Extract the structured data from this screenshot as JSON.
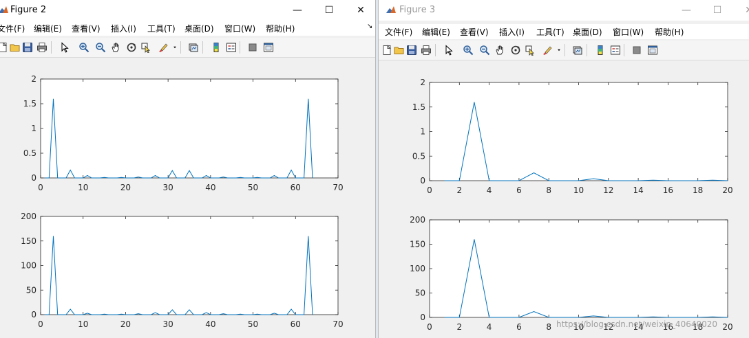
{
  "colors": {
    "line": "#0072bd",
    "axis": "#262626",
    "plot_bg": "#ffffff",
    "figure_bg": "#f0f0f0"
  },
  "windows": [
    {
      "id": "fig2",
      "title": "Figure 2",
      "icon": "matlab-icon",
      "controls": {
        "minimize": "—",
        "maximize": "☐",
        "close": "✕"
      },
      "menu": [
        "文件(F)",
        "编辑(E)",
        "查看(V)",
        "插入(I)",
        "工具(T)",
        "桌面(D)",
        "窗口(W)",
        "帮助(H)"
      ],
      "menu_arrow": "↘",
      "toolbar": [
        "new-figure-icon",
        "open-file-icon",
        "save-icon",
        "print-icon",
        "pointer-icon",
        "zoom-in-icon",
        "zoom-out-icon",
        "pan-icon",
        "rotate-3d-icon",
        "data-cursor-icon",
        "brush-icon",
        "brush-dropdown-icon",
        "link-plot-icon",
        "colorbar-icon",
        "legend-icon",
        "hide-plot-tools-icon",
        "show-plot-tools-icon"
      ]
    },
    {
      "id": "fig3",
      "title": "Figure 3",
      "icon": "matlab-icon",
      "controls": {
        "minimize": "—",
        "maximize": "☐",
        "close": "✕"
      },
      "menu": [
        "文件(F)",
        "编辑(E)",
        "查看(V)",
        "插入(I)",
        "工具(T)",
        "桌面(D)",
        "窗口(W)",
        "帮助(H)"
      ],
      "menu_arrow": "",
      "toolbar": [
        "new-figure-icon",
        "open-file-icon",
        "save-icon",
        "print-icon",
        "pointer-icon",
        "zoom-in-icon",
        "zoom-out-icon",
        "pan-icon",
        "rotate-3d-icon",
        "data-cursor-icon",
        "brush-icon",
        "brush-dropdown-icon",
        "link-plot-icon",
        "colorbar-icon",
        "legend-icon",
        "hide-plot-tools-icon",
        "show-plot-tools-icon"
      ]
    }
  ],
  "chart_data": [
    {
      "type": "line",
      "figure": "Figure 2",
      "xlim": [
        0,
        70
      ],
      "ylim": [
        0,
        2
      ],
      "xticks": [
        "0",
        "10",
        "20",
        "30",
        "40",
        "50",
        "60",
        "70"
      ],
      "yticks": [
        "0",
        "0.5",
        "1",
        "1.5",
        "2"
      ],
      "x": [
        1,
        2,
        3,
        4,
        5,
        6,
        7,
        8,
        9,
        10,
        11,
        12,
        13,
        14,
        15,
        16,
        17,
        18,
        19,
        20,
        21,
        22,
        23,
        24,
        25,
        26,
        27,
        28,
        29,
        30,
        31,
        32,
        33,
        34,
        35,
        36,
        37,
        38,
        39,
        40,
        41,
        42,
        43,
        44,
        45,
        46,
        47,
        48,
        49,
        50,
        51,
        52,
        53,
        54,
        55,
        56,
        57,
        58,
        59,
        60,
        61,
        62,
        63,
        64
      ],
      "y": [
        0,
        0,
        1.6,
        0,
        0,
        0,
        0.16,
        0,
        0,
        0,
        0.05,
        0,
        0,
        0,
        0.01,
        0,
        0,
        0,
        0.01,
        0,
        0,
        0,
        0.02,
        0,
        0,
        0,
        0.05,
        0,
        0,
        0,
        0.15,
        0,
        0,
        0,
        0.15,
        0,
        0,
        0,
        0.05,
        0,
        0,
        0,
        0.02,
        0,
        0,
        0,
        0.01,
        0,
        0,
        0,
        0.01,
        0,
        0,
        0,
        0.05,
        0,
        0,
        0,
        0.16,
        0,
        0,
        0,
        1.6,
        0
      ]
    },
    {
      "type": "line",
      "figure": "Figure 2",
      "xlim": [
        0,
        70
      ],
      "ylim": [
        0,
        200
      ],
      "xticks": [
        "0",
        "10",
        "20",
        "30",
        "40",
        "50",
        "60",
        "70"
      ],
      "yticks": [
        "0",
        "50",
        "100",
        "150",
        "200"
      ],
      "x": [
        1,
        2,
        3,
        4,
        5,
        6,
        7,
        8,
        9,
        10,
        11,
        12,
        13,
        14,
        15,
        16,
        17,
        18,
        19,
        20,
        21,
        22,
        23,
        24,
        25,
        26,
        27,
        28,
        29,
        30,
        31,
        32,
        33,
        34,
        35,
        36,
        37,
        38,
        39,
        40,
        41,
        42,
        43,
        44,
        45,
        46,
        47,
        48,
        49,
        50,
        51,
        52,
        53,
        54,
        55,
        56,
        57,
        58,
        59,
        60,
        61,
        62,
        63,
        64
      ],
      "y": [
        0,
        0,
        160,
        0,
        0,
        0,
        11,
        0,
        0,
        0,
        3,
        0,
        0,
        0,
        1,
        0,
        0,
        0,
        1,
        0,
        0,
        0,
        2,
        0,
        0,
        0,
        4,
        0,
        0,
        0,
        10,
        0,
        0,
        0,
        10,
        0,
        0,
        0,
        4,
        0,
        0,
        0,
        2,
        0,
        0,
        0,
        1,
        0,
        0,
        0,
        1,
        0,
        0,
        0,
        3,
        0,
        0,
        0,
        11,
        0,
        0,
        0,
        160,
        0
      ]
    },
    {
      "type": "line",
      "figure": "Figure 3",
      "xlim": [
        0,
        20
      ],
      "ylim": [
        0,
        2
      ],
      "xticks": [
        "0",
        "2",
        "4",
        "6",
        "8",
        "10",
        "12",
        "14",
        "16",
        "18",
        "20"
      ],
      "yticks": [
        "0",
        "0.5",
        "1",
        "1.5",
        "2"
      ],
      "x": [
        1,
        2,
        3,
        4,
        5,
        6,
        7,
        8,
        9,
        10,
        11,
        12,
        13,
        14,
        15,
        16,
        17,
        18,
        19,
        20
      ],
      "y": [
        0,
        0,
        1.6,
        0,
        0,
        0,
        0.16,
        0,
        0,
        0,
        0.04,
        0,
        0,
        0,
        0.01,
        0,
        0,
        0,
        0.01,
        0
      ]
    },
    {
      "type": "line",
      "figure": "Figure 3",
      "xlim": [
        0,
        20
      ],
      "ylim": [
        0,
        200
      ],
      "xticks": [
        "0",
        "2",
        "4",
        "6",
        "8",
        "10",
        "12",
        "14",
        "16",
        "18",
        "20"
      ],
      "yticks": [
        "0",
        "50",
        "100",
        "150",
        "200"
      ],
      "x": [
        1,
        2,
        3,
        4,
        5,
        6,
        7,
        8,
        9,
        10,
        11,
        12,
        13,
        14,
        15,
        16,
        17,
        18,
        19,
        20
      ],
      "y": [
        0,
        0,
        160,
        0,
        0,
        0,
        12,
        0,
        0,
        0,
        3,
        0,
        0,
        0,
        1,
        0,
        0,
        0,
        1,
        0
      ]
    }
  ],
  "watermark": "https://blog.csdn.net/weixin_40640020"
}
